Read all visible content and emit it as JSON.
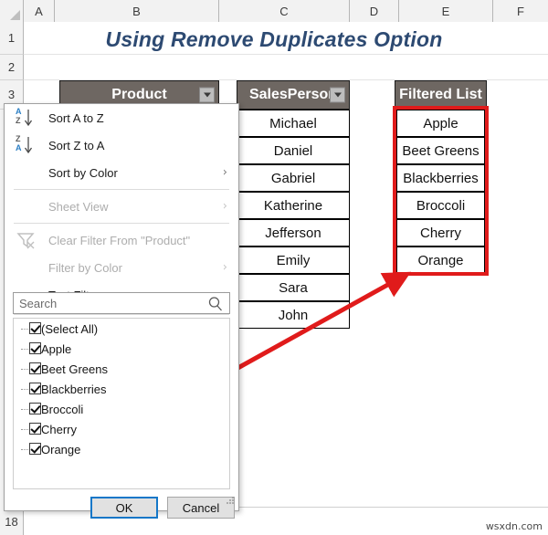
{
  "sheet": {
    "title": "Using Remove Duplicates Option",
    "title_color": "#2d4a72",
    "column_headers": [
      "A",
      "B",
      "C",
      "D",
      "E",
      "F"
    ],
    "row_headers": [
      "1",
      "2",
      "3",
      "18"
    ]
  },
  "table": {
    "header_bg": "#6e6762",
    "product_header": "Product",
    "salesperson_header": "SalesPerson",
    "filtered_header": "Filtered List",
    "salespersons": [
      "Michael",
      "Daniel",
      "Gabriel",
      "Katherine",
      "Jefferson",
      "Emily",
      "Sara",
      "John"
    ],
    "filtered_list": [
      "Apple",
      "Beet Greens",
      "Blackberries",
      "Broccoli",
      "Cherry",
      "Orange"
    ]
  },
  "filter_menu": {
    "items": [
      {
        "label": "Sort A to Z",
        "icon": "sort-ascending-icon",
        "disabled": false,
        "submenu": false
      },
      {
        "label": "Sort Z to A",
        "icon": "sort-descending-icon",
        "disabled": false,
        "submenu": false
      },
      {
        "label": "Sort by Color",
        "icon": "",
        "disabled": false,
        "submenu": true
      },
      {
        "label": "Sheet View",
        "icon": "",
        "disabled": true,
        "submenu": true
      },
      {
        "label": "Clear Filter From \"Product\"",
        "icon": "clear-filter-icon",
        "disabled": true,
        "submenu": false
      },
      {
        "label": "Filter by Color",
        "icon": "",
        "disabled": true,
        "submenu": true
      },
      {
        "label": "Text Filters",
        "icon": "",
        "disabled": false,
        "submenu": true
      }
    ],
    "search_placeholder": "Search",
    "search_value": "",
    "checkbox_items": [
      {
        "label": "(Select All)",
        "checked": true
      },
      {
        "label": "Apple",
        "checked": true
      },
      {
        "label": "Beet Greens",
        "checked": true
      },
      {
        "label": "Blackberries",
        "checked": true
      },
      {
        "label": "Broccoli",
        "checked": true
      },
      {
        "label": "Cherry",
        "checked": true
      },
      {
        "label": "Orange",
        "checked": true
      }
    ],
    "ok_label": "OK",
    "cancel_label": "Cancel"
  },
  "annotation": {
    "color": "#e01b1b"
  },
  "watermark": "wsxdn.com"
}
